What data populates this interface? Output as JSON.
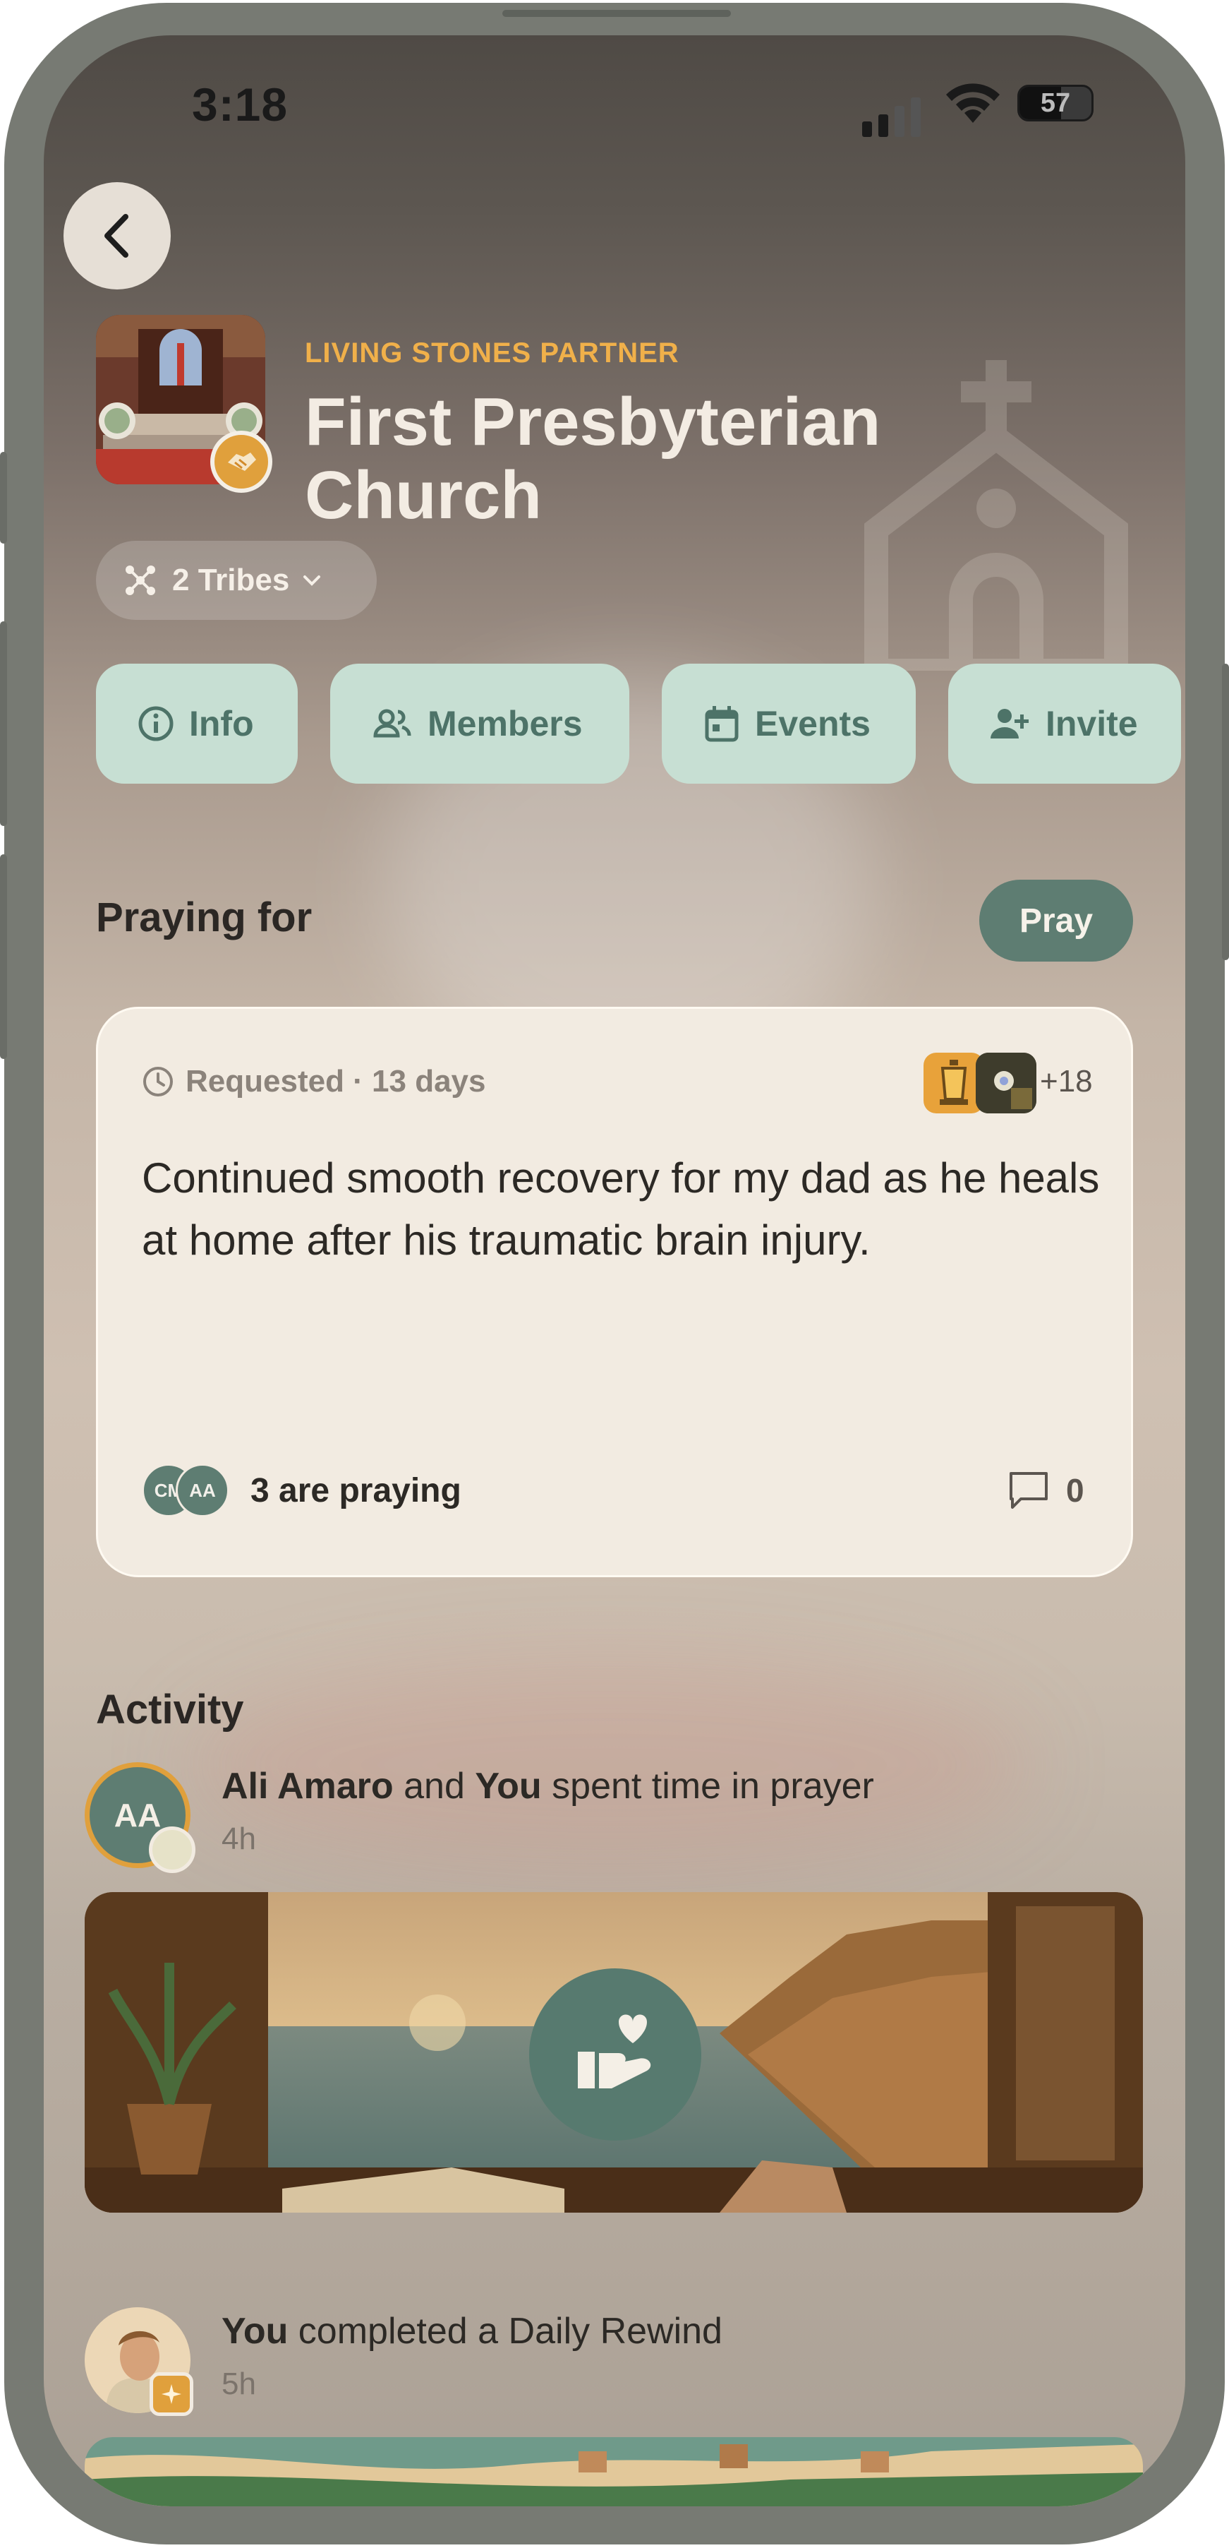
{
  "status_bar": {
    "time": "3:18",
    "battery": "57"
  },
  "header": {
    "partner_label": "LIVING STONES PARTNER",
    "church_name": "First Presbyterian Church",
    "tribes_label": "2 Tribes"
  },
  "tabs": [
    {
      "label": "Info",
      "icon": "info-icon"
    },
    {
      "label": "Members",
      "icon": "members-icon"
    },
    {
      "label": "Events",
      "icon": "calendar-icon"
    },
    {
      "label": "Invite",
      "icon": "add-person-icon"
    }
  ],
  "praying_for": {
    "title": "Praying for",
    "pray_button": "Pray",
    "card": {
      "requested": "Requested · 13 days",
      "extra_count": "+18",
      "request_text": "Continued smooth recovery for my dad as he heals at home after his traumatic brain injury.",
      "prayer_avatars": [
        "CM",
        "AA"
      ],
      "praying_count_text": "3 are praying",
      "comment_count": "0"
    }
  },
  "activity": {
    "title": "Activity",
    "items": [
      {
        "avatar_initials": "AA",
        "bold1": "Ali Amaro",
        "mid": " and ",
        "bold2": "You",
        "rest": " spent time in prayer",
        "time": "4h"
      },
      {
        "bold1": "You",
        "rest": " completed a Daily Rewind",
        "time": "5h"
      }
    ]
  },
  "colors": {
    "accent": "#5e7d72",
    "tab_bg": "#c7dfd3",
    "partner_gold": "#f0b04a",
    "card_bg": "#f2ebe1"
  }
}
